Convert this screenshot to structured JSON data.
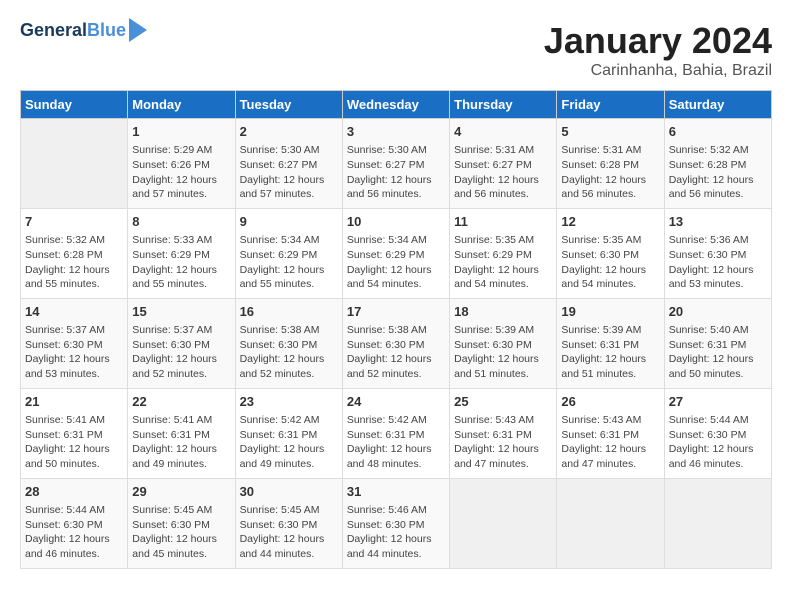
{
  "logo": {
    "line1": "General",
    "line2": "Blue"
  },
  "title": "January 2024",
  "location": "Carinhanha, Bahia, Brazil",
  "headers": [
    "Sunday",
    "Monday",
    "Tuesday",
    "Wednesday",
    "Thursday",
    "Friday",
    "Saturday"
  ],
  "weeks": [
    [
      {
        "day": "",
        "content": ""
      },
      {
        "day": "1",
        "content": "Sunrise: 5:29 AM\nSunset: 6:26 PM\nDaylight: 12 hours\nand 57 minutes."
      },
      {
        "day": "2",
        "content": "Sunrise: 5:30 AM\nSunset: 6:27 PM\nDaylight: 12 hours\nand 57 minutes."
      },
      {
        "day": "3",
        "content": "Sunrise: 5:30 AM\nSunset: 6:27 PM\nDaylight: 12 hours\nand 56 minutes."
      },
      {
        "day": "4",
        "content": "Sunrise: 5:31 AM\nSunset: 6:27 PM\nDaylight: 12 hours\nand 56 minutes."
      },
      {
        "day": "5",
        "content": "Sunrise: 5:31 AM\nSunset: 6:28 PM\nDaylight: 12 hours\nand 56 minutes."
      },
      {
        "day": "6",
        "content": "Sunrise: 5:32 AM\nSunset: 6:28 PM\nDaylight: 12 hours\nand 56 minutes."
      }
    ],
    [
      {
        "day": "7",
        "content": "Sunrise: 5:32 AM\nSunset: 6:28 PM\nDaylight: 12 hours\nand 55 minutes."
      },
      {
        "day": "8",
        "content": "Sunrise: 5:33 AM\nSunset: 6:29 PM\nDaylight: 12 hours\nand 55 minutes."
      },
      {
        "day": "9",
        "content": "Sunrise: 5:34 AM\nSunset: 6:29 PM\nDaylight: 12 hours\nand 55 minutes."
      },
      {
        "day": "10",
        "content": "Sunrise: 5:34 AM\nSunset: 6:29 PM\nDaylight: 12 hours\nand 54 minutes."
      },
      {
        "day": "11",
        "content": "Sunrise: 5:35 AM\nSunset: 6:29 PM\nDaylight: 12 hours\nand 54 minutes."
      },
      {
        "day": "12",
        "content": "Sunrise: 5:35 AM\nSunset: 6:30 PM\nDaylight: 12 hours\nand 54 minutes."
      },
      {
        "day": "13",
        "content": "Sunrise: 5:36 AM\nSunset: 6:30 PM\nDaylight: 12 hours\nand 53 minutes."
      }
    ],
    [
      {
        "day": "14",
        "content": "Sunrise: 5:37 AM\nSunset: 6:30 PM\nDaylight: 12 hours\nand 53 minutes."
      },
      {
        "day": "15",
        "content": "Sunrise: 5:37 AM\nSunset: 6:30 PM\nDaylight: 12 hours\nand 52 minutes."
      },
      {
        "day": "16",
        "content": "Sunrise: 5:38 AM\nSunset: 6:30 PM\nDaylight: 12 hours\nand 52 minutes."
      },
      {
        "day": "17",
        "content": "Sunrise: 5:38 AM\nSunset: 6:30 PM\nDaylight: 12 hours\nand 52 minutes."
      },
      {
        "day": "18",
        "content": "Sunrise: 5:39 AM\nSunset: 6:30 PM\nDaylight: 12 hours\nand 51 minutes."
      },
      {
        "day": "19",
        "content": "Sunrise: 5:39 AM\nSunset: 6:31 PM\nDaylight: 12 hours\nand 51 minutes."
      },
      {
        "day": "20",
        "content": "Sunrise: 5:40 AM\nSunset: 6:31 PM\nDaylight: 12 hours\nand 50 minutes."
      }
    ],
    [
      {
        "day": "21",
        "content": "Sunrise: 5:41 AM\nSunset: 6:31 PM\nDaylight: 12 hours\nand 50 minutes."
      },
      {
        "day": "22",
        "content": "Sunrise: 5:41 AM\nSunset: 6:31 PM\nDaylight: 12 hours\nand 49 minutes."
      },
      {
        "day": "23",
        "content": "Sunrise: 5:42 AM\nSunset: 6:31 PM\nDaylight: 12 hours\nand 49 minutes."
      },
      {
        "day": "24",
        "content": "Sunrise: 5:42 AM\nSunset: 6:31 PM\nDaylight: 12 hours\nand 48 minutes."
      },
      {
        "day": "25",
        "content": "Sunrise: 5:43 AM\nSunset: 6:31 PM\nDaylight: 12 hours\nand 47 minutes."
      },
      {
        "day": "26",
        "content": "Sunrise: 5:43 AM\nSunset: 6:31 PM\nDaylight: 12 hours\nand 47 minutes."
      },
      {
        "day": "27",
        "content": "Sunrise: 5:44 AM\nSunset: 6:30 PM\nDaylight: 12 hours\nand 46 minutes."
      }
    ],
    [
      {
        "day": "28",
        "content": "Sunrise: 5:44 AM\nSunset: 6:30 PM\nDaylight: 12 hours\nand 46 minutes."
      },
      {
        "day": "29",
        "content": "Sunrise: 5:45 AM\nSunset: 6:30 PM\nDaylight: 12 hours\nand 45 minutes."
      },
      {
        "day": "30",
        "content": "Sunrise: 5:45 AM\nSunset: 6:30 PM\nDaylight: 12 hours\nand 44 minutes."
      },
      {
        "day": "31",
        "content": "Sunrise: 5:46 AM\nSunset: 6:30 PM\nDaylight: 12 hours\nand 44 minutes."
      },
      {
        "day": "",
        "content": ""
      },
      {
        "day": "",
        "content": ""
      },
      {
        "day": "",
        "content": ""
      }
    ]
  ]
}
